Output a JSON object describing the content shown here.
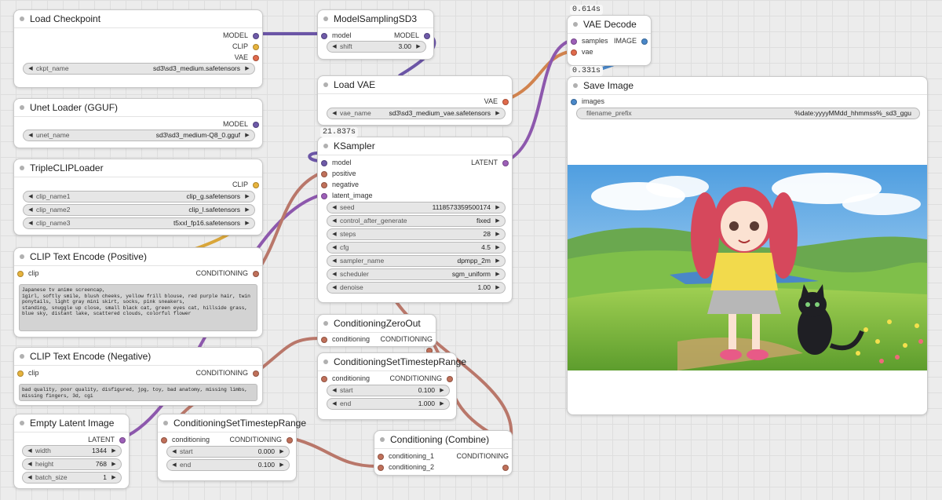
{
  "colors": {
    "model": "#6e5aa8",
    "clip": "#e7b33c",
    "vae": "#e06a4b",
    "conditioning": "#c0705a",
    "latent": "#9d5fb8",
    "image": "#4a88c9",
    "wire_model": "#6b55a6",
    "wire_latent": "#8d58ad",
    "wire_cond": "#b9776a",
    "wire_vae": "#d1834e",
    "wire_clip": "#d9a63a"
  },
  "timings": {
    "vae_decode": "0.614s",
    "save_image": "0.331s",
    "ksampler": "21.837s"
  },
  "load_checkpoint": {
    "title": "Load Checkpoint",
    "outputs": [
      "MODEL",
      "CLIP",
      "VAE"
    ],
    "ckpt_name_label": "ckpt_name",
    "ckpt_name_value": "sd3\\sd3_medium.safetensors"
  },
  "unet_loader": {
    "title": "Unet Loader (GGUF)",
    "output": "MODEL",
    "unet_name_label": "unet_name",
    "unet_name_value": "sd3\\sd3_medium-Q8_0.gguf"
  },
  "triple_clip": {
    "title": "TripleCLIPLoader",
    "output": "CLIP",
    "widgets": [
      {
        "label": "clip_name1",
        "value": "clip_g.safetensors"
      },
      {
        "label": "clip_name2",
        "value": "clip_l.safetensors"
      },
      {
        "label": "clip_name3",
        "value": "t5xxl_fp16.safetensors"
      }
    ]
  },
  "clip_pos": {
    "title": "CLIP Text Encode (Positive)",
    "input": "clip",
    "output": "CONDITIONING",
    "text": "Japanese tv anime screencap,\n1girl, softly smile, blush cheeks, yellow frill blouse, red purple hair, twin ponytails, light gray mini skirt, socks, pink sneakers,\nstanding, snuggle up close, small black cat, green eyes cat, hillside grass, blue sky, distant lake, scattered clouds, colorful flower"
  },
  "clip_neg": {
    "title": "CLIP Text Encode (Negative)",
    "input": "clip",
    "output": "CONDITIONING",
    "text": "bad quality, poor quality, disfigured, jpg, toy, bad anatomy, missing limbs, missing fingers, 3d, cgi"
  },
  "empty_latent": {
    "title": "Empty Latent Image",
    "output": "LATENT",
    "widgets": [
      {
        "label": "width",
        "value": "1344"
      },
      {
        "label": "height",
        "value": "768"
      },
      {
        "label": "batch_size",
        "value": "1"
      }
    ]
  },
  "model_sampling": {
    "title": "ModelSamplingSD3",
    "input": "model",
    "output": "MODEL",
    "shift_label": "shift",
    "shift_value": "3.00"
  },
  "load_vae": {
    "title": "Load VAE",
    "output": "VAE",
    "vae_name_label": "vae_name",
    "vae_name_value": "sd3\\sd3_medium_vae.safetensors"
  },
  "ksampler": {
    "title": "KSampler",
    "inputs": [
      "model",
      "positive",
      "negative",
      "latent_image"
    ],
    "output": "LATENT",
    "widgets": [
      {
        "label": "seed",
        "value": "1118573359500174"
      },
      {
        "label": "control_after_generate",
        "value": "fixed"
      },
      {
        "label": "steps",
        "value": "28"
      },
      {
        "label": "cfg",
        "value": "4.5"
      },
      {
        "label": "sampler_name",
        "value": "dpmpp_2m"
      },
      {
        "label": "scheduler",
        "value": "sgm_uniform"
      },
      {
        "label": "denoise",
        "value": "1.00"
      }
    ]
  },
  "cond_zero_out": {
    "title": "ConditioningZeroOut",
    "input": "conditioning",
    "output": "CONDITIONING"
  },
  "cond_ts_range_a": {
    "title": "ConditioningSetTimestepRange",
    "input": "conditioning",
    "output": "CONDITIONING",
    "widgets": [
      {
        "label": "start",
        "value": "0.100"
      },
      {
        "label": "end",
        "value": "1.000"
      }
    ]
  },
  "cond_ts_range_b": {
    "title": "ConditioningSetTimestepRange",
    "input": "conditioning",
    "output": "CONDITIONING",
    "widgets": [
      {
        "label": "start",
        "value": "0.000"
      },
      {
        "label": "end",
        "value": "0.100"
      }
    ]
  },
  "cond_combine": {
    "title": "Conditioning (Combine)",
    "inputs": [
      "conditioning_1",
      "conditioning_2"
    ],
    "output": "CONDITIONING"
  },
  "vae_decode": {
    "title": "VAE Decode",
    "inputs": [
      "samples",
      "vae"
    ],
    "output": "IMAGE"
  },
  "save_image": {
    "title": "Save Image",
    "input": "images",
    "filename_prefix_label": "filename_prefix",
    "filename_prefix_value": "%date:yyyyMMdd_hhmmss%_sd3_ggu"
  }
}
